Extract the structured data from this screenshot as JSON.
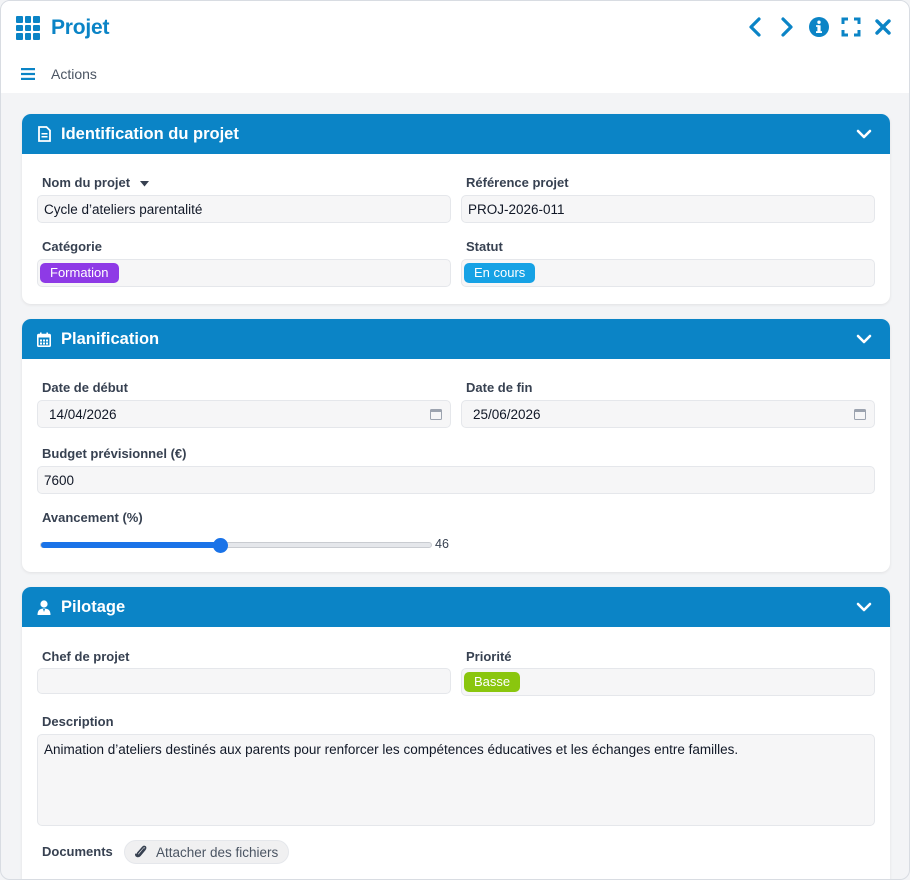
{
  "window": {
    "title": "Projet",
    "actions_label": "Actions"
  },
  "colors": {
    "accent": "#0b84c6",
    "formation": "#8e3ae6",
    "en_cours": "#16a2e5",
    "basse": "#8ac60e",
    "slider": "#1a73e8"
  },
  "sections": {
    "identification": {
      "title": "Identification du projet",
      "icon": "document-icon",
      "nom_label": "Nom du projet",
      "nom_value": "Cycle d’ateliers parentalité",
      "reference_label": "Référence projet",
      "reference_value": "PROJ-2026-011",
      "categorie_label": "Catégorie",
      "categorie_value": "Formation",
      "statut_label": "Statut",
      "statut_value": "En cours"
    },
    "planification": {
      "title": "Planification",
      "icon": "calendar-icon",
      "date_debut_label": "Date de début",
      "date_debut_value": "14/04/2026",
      "date_fin_label": "Date de fin",
      "date_fin_value": "25/06/2026",
      "budget_label": "Budget prévisionnel (€)",
      "budget_value": "7600",
      "avancement_label": "Avancement (%)",
      "avancement_value": "46",
      "avancement_percent": 46
    },
    "pilotage": {
      "title": "Pilotage",
      "icon": "user-icon",
      "chef_label": "Chef de projet",
      "chef_value": "",
      "priorite_label": "Priorité",
      "priorite_value": "Basse",
      "description_label": "Description",
      "description_value": "Animation d’ateliers destinés aux parents pour renforcer les compétences éducatives et les échanges entre familles.",
      "documents_label": "Documents",
      "attach_label": "Attacher des fichiers"
    }
  }
}
